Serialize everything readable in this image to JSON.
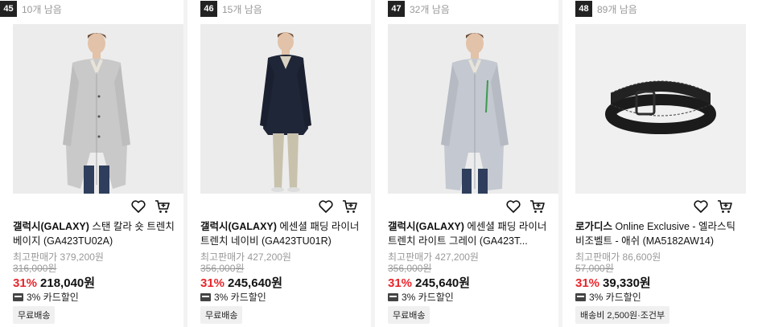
{
  "products": [
    {
      "rank": "45",
      "remaining": "10개 남음",
      "brand": "갤럭시(GALAXY)",
      "name": " 스탠 칼라 숏 트렌치 베이지 (GA423TU02A)",
      "max_price": "최고판매가 379,200원",
      "original_price": "316,000원",
      "discount": "31%",
      "sale_price": "218,040원",
      "card_discount": "3% 카드할인",
      "shipping": "무료배송",
      "image": "light-coat"
    },
    {
      "rank": "46",
      "remaining": "15개 남음",
      "brand": "갤럭시(GALAXY)",
      "name": " 에센셜 패딩 라이너 트렌치 네이비 (GA423TU01R)",
      "max_price": "최고판매가 427,200원",
      "original_price": "356,000원",
      "discount": "31%",
      "sale_price": "245,640원",
      "card_discount": "3% 카드할인",
      "shipping": "무료배송",
      "image": "navy-coat"
    },
    {
      "rank": "47",
      "remaining": "32개 남음",
      "brand": "갤럭시(GALAXY)",
      "name": " 에센셜 패딩 라이너 트렌치 라이트 그레이 (GA423T...",
      "max_price": "최고판매가 427,200원",
      "original_price": "356,000원",
      "discount": "31%",
      "sale_price": "245,640원",
      "card_discount": "3% 카드할인",
      "shipping": "무료배송",
      "image": "grey-coat"
    },
    {
      "rank": "48",
      "remaining": "89개 남음",
      "brand": "로가디스",
      "name": " Online Exclusive - 엘라스틱 비조벨트 - 애쉬 (MA5182AW14)",
      "max_price": "최고판매가 86,600원",
      "original_price": "57,000원",
      "discount": "31%",
      "sale_price": "39,330원",
      "card_discount": "3% 카드할인",
      "shipping": "배송비 2,500원·조건부",
      "image": "belt"
    }
  ],
  "colors": {
    "discount": "#e8262b",
    "badge_bg": "#222222",
    "muted": "#999999"
  },
  "icons": [
    "heart-icon",
    "cart-icon",
    "card-icon"
  ]
}
